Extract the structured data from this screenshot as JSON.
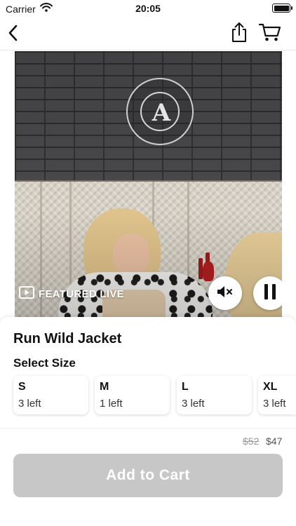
{
  "status_bar": {
    "carrier": "Carrier",
    "time": "20:05",
    "icons": [
      "wifi-icon",
      "battery-icon"
    ]
  },
  "nav": {
    "icons": [
      "chevron-left-icon",
      "share-icon",
      "cart-icon"
    ]
  },
  "video": {
    "featured_label": "FEATURED LIVE",
    "sign_letter": "A",
    "controls": [
      "mute-icon",
      "pause-icon"
    ]
  },
  "product": {
    "name": "Run Wild Jacket",
    "size_heading": "Select Size",
    "sizes": [
      {
        "label": "S",
        "stock": "3 left"
      },
      {
        "label": "M",
        "stock": "1 left"
      },
      {
        "label": "L",
        "stock": "3 left"
      },
      {
        "label": "XL",
        "stock": "3 left"
      }
    ]
  },
  "pricing": {
    "original_price": "$52",
    "sale_price": "$47"
  },
  "cta": {
    "add_to_cart_label": "Add to Cart",
    "enabled": false
  },
  "colors": {
    "button_disabled": "#c7c7c7",
    "vase_red": "#b21f1f"
  }
}
